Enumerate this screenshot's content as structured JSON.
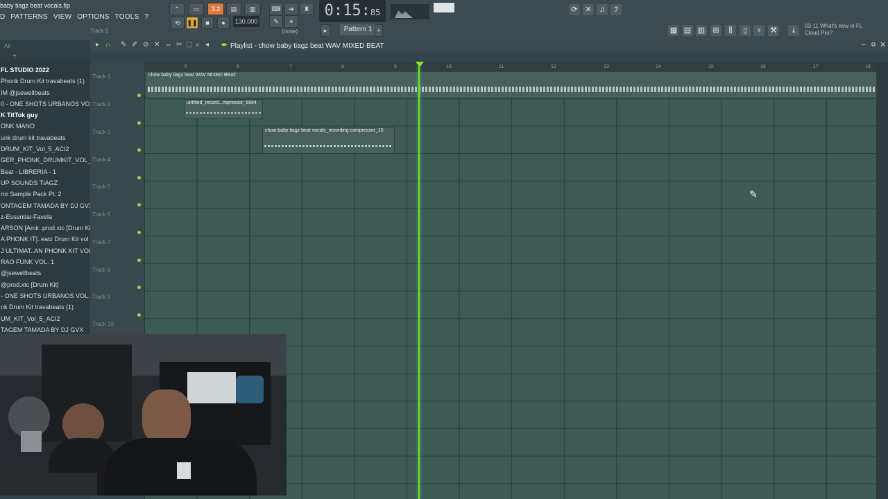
{
  "window": {
    "file_title": "baby tiagz beat vocals.flp"
  },
  "menu": {
    "items": [
      "D",
      "PATTERNS",
      "VIEW",
      "OPTIONS",
      "TOOLS",
      "?"
    ]
  },
  "toolbar": {
    "track_hint": "Track 5",
    "time_main": "0:15",
    "time_sub": "85",
    "tempo": "130.000",
    "pattern": "Pattern 1",
    "snap": "(none)",
    "news_line1": "03-11  What's new in FL",
    "news_line2": "Cloud Pro?",
    "record_mode": "3.2"
  },
  "browser": {
    "filter": "All",
    "items": [
      "FL STUDIO 2022",
      "Phonk Drum Kit travabeats (1)",
      "IM @jsewellbeats",
      "0 - ONE SHOTS URBANOS VOL. 2",
      "K TitTok guy",
      "ONK MANO",
      "unk drum kit travabeats",
      "DRUM_KIT_Vol_5_ACI2",
      "GER_PHONK_DRUMKIT_VOL_3",
      "Beat - LIBRERIA - 1",
      "UP SOUNDS TIAGZ",
      "ror Sample Pack Pt. 2",
      "ONTAGEM TAMADA BY DJ GVX",
      "z-Essential-Favela",
      "ARSON [Amir..prod.xtc [Drum Kit]",
      "A PHONK IT]..eatz Drum Kit vol 1",
      "J ULTIMAT..AN PHONK KIT VOL. 3",
      "RAO FUNK VOL. 1",
      "@jsewellbeats",
      "@prod.xtc [Drum Kit]",
      "- ONE SHOTS URBANOS VOL. 2",
      "nk Drum Kit travabeats (1)",
      "UM_KIT_Vol_5_ACI2",
      "TAGEM TAMADA BY DJ GVX"
    ]
  },
  "playlist": {
    "title": "Playlist - chow baby tiagz beat WAV MIXED BEAT",
    "tracks": [
      "Track 1",
      "Track 2",
      "Track 3",
      "Track 4",
      "Track 5",
      "Track 6",
      "Track 7",
      "Track 8",
      "Track 9",
      "Track 10"
    ],
    "bar_numbers": [
      "5",
      "6",
      "7",
      "8",
      "9",
      "10",
      "11",
      "12",
      "13",
      "14",
      "15",
      "16",
      "17",
      "18"
    ],
    "clips": [
      {
        "label": "chow baby tiagz beat WAV MIXED BEAT"
      },
      {
        "label": "untitled_record...mpressor_6684"
      },
      {
        "label": "chow baby tiagz beat vocals_recording compressor_15"
      }
    ]
  },
  "colors": {
    "playhead": "#5ee63a",
    "grid": "#3d5a55",
    "accent": "#e07a3c"
  }
}
